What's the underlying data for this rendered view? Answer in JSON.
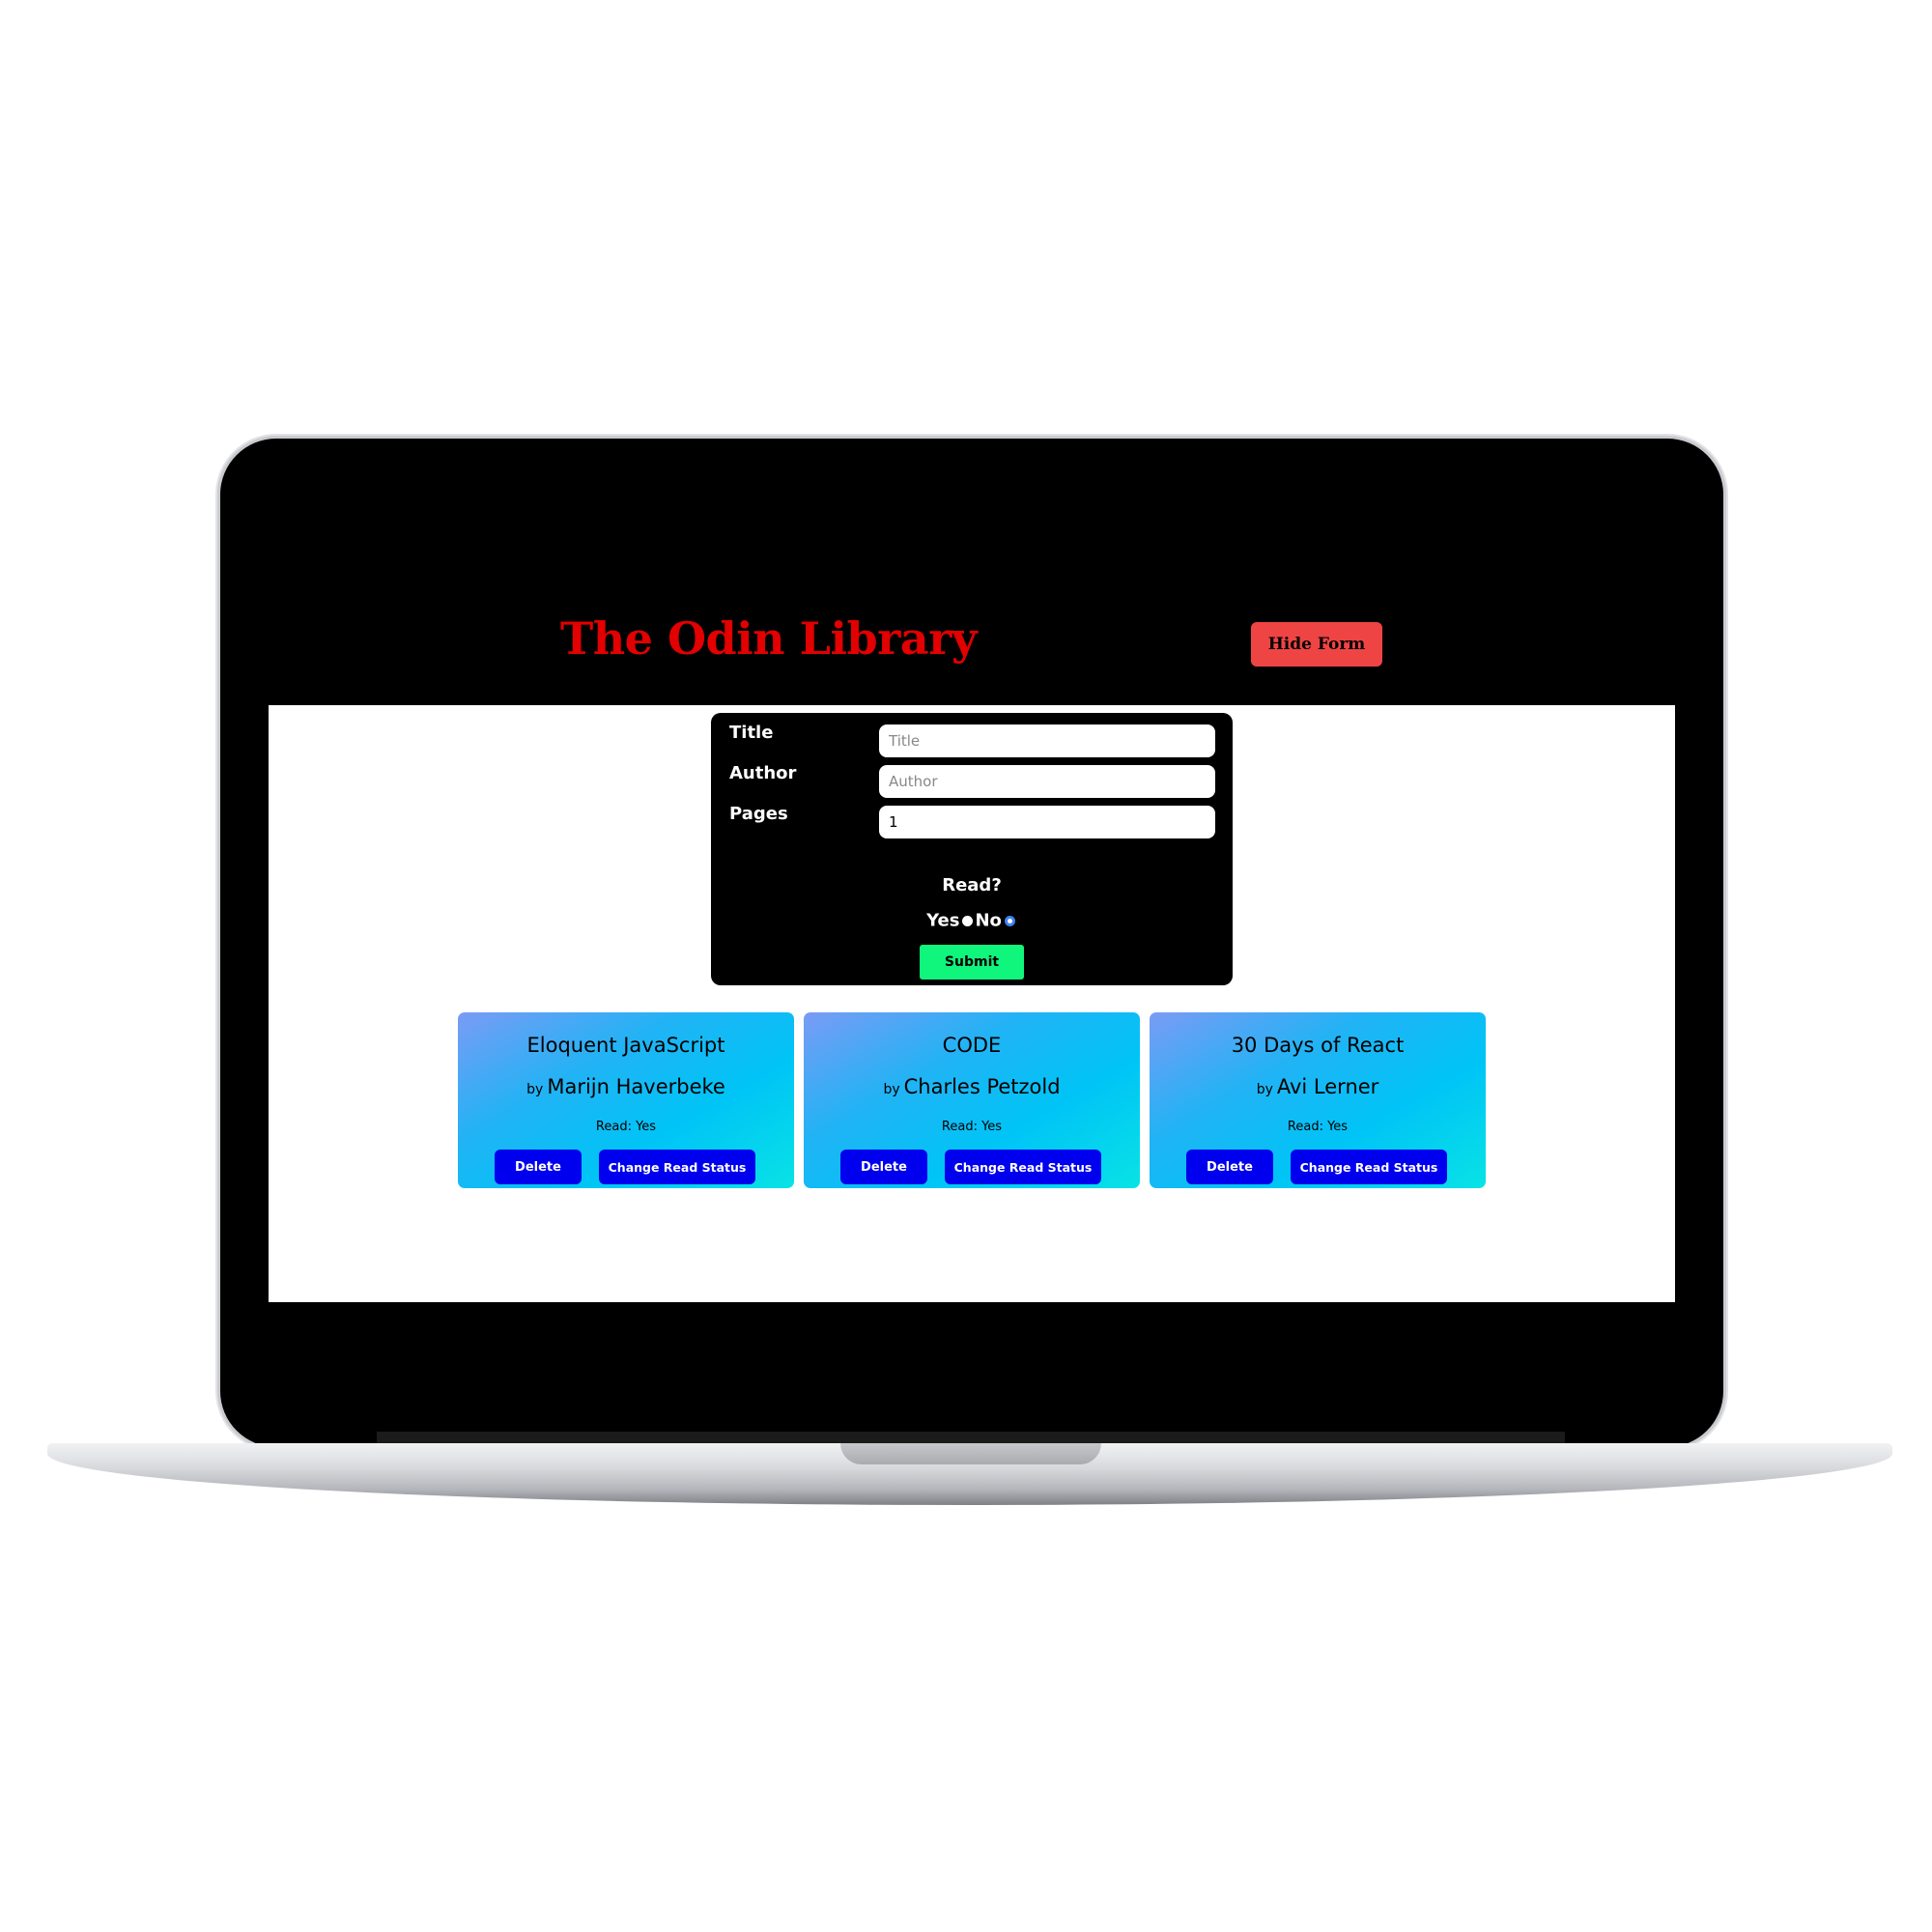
{
  "header": {
    "title": "The Odin Library",
    "hide_form_label": "Hide Form"
  },
  "form": {
    "title_label": "Title",
    "title_placeholder": "Title",
    "author_label": "Author",
    "author_placeholder": "Author",
    "pages_label": "Pages",
    "pages_value": "1",
    "read_label": "Read?",
    "yes_label": "Yes",
    "no_label": "No",
    "submit_label": "Submit"
  },
  "books": [
    {
      "title": "Eloquent JavaScript",
      "by": "by",
      "author": "Marijn Haverbeke",
      "read": "Read: Yes",
      "delete_label": "Delete",
      "status_label": "Change Read Status"
    },
    {
      "title": "CODE",
      "by": "by",
      "author": "Charles Petzold",
      "read": "Read: Yes",
      "delete_label": "Delete",
      "status_label": "Change Read Status"
    },
    {
      "title": "30 Days of React",
      "by": "by",
      "author": "Avi Lerner",
      "read": "Read: Yes",
      "delete_label": "Delete",
      "status_label": "Change Read Status"
    }
  ],
  "colors": {
    "title_red": "#e20000",
    "hide_button": "#ef4444",
    "submit_green": "#10f57c",
    "card_button_blue": "#0000ee"
  }
}
